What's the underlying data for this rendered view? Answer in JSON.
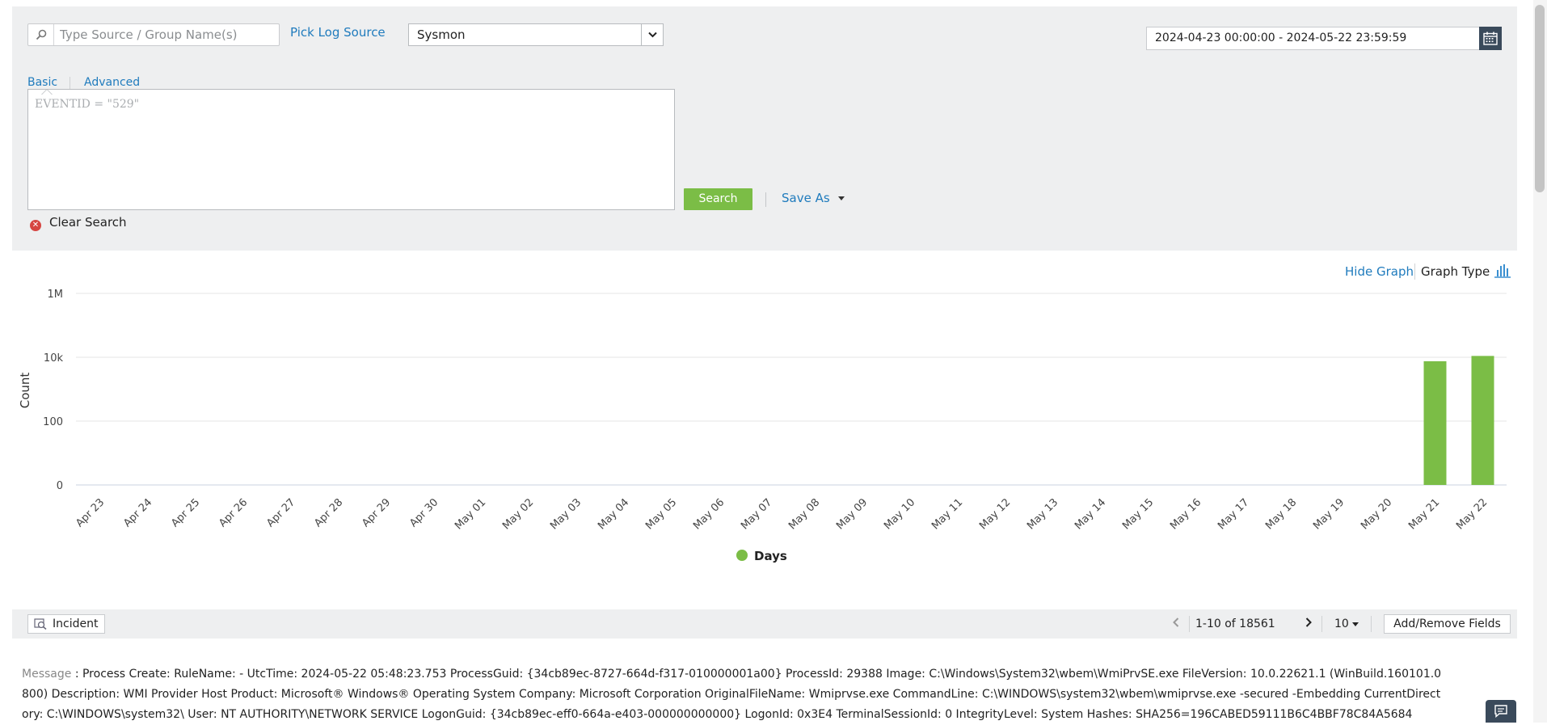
{
  "search": {
    "placeholder": "Type Source / Group Name(s)",
    "pick_log_source": "Pick Log Source",
    "log_source_selected": "Sysmon"
  },
  "date_range": "2024-04-23 00:00:00 - 2024-05-22 23:59:59",
  "tabs": {
    "basic": "Basic",
    "advanced": "Advanced",
    "active": "Basic"
  },
  "query": {
    "placeholder": "EVENTID = \"529\""
  },
  "actions": {
    "search": "Search",
    "save_as": "Save As",
    "clear_search": "Clear Search"
  },
  "graph_controls": {
    "hide_graph": "Hide Graph",
    "graph_type": "Graph Type"
  },
  "chart_data": {
    "type": "bar",
    "ylabel": "Count",
    "xlabel": "",
    "y_scale": "log",
    "y_ticks": [
      "0",
      "100",
      "10k",
      "1M"
    ],
    "categories": [
      "Apr 23",
      "Apr 24",
      "Apr 25",
      "Apr 26",
      "Apr 27",
      "Apr 28",
      "Apr 29",
      "Apr 30",
      "May 01",
      "May 02",
      "May 03",
      "May 04",
      "May 05",
      "May 06",
      "May 07",
      "May 08",
      "May 09",
      "May 10",
      "May 11",
      "May 12",
      "May 13",
      "May 14",
      "May 15",
      "May 16",
      "May 17",
      "May 18",
      "May 19",
      "May 20",
      "May 21",
      "May 22"
    ],
    "series": [
      {
        "name": "Days",
        "color": "#7bbd46",
        "values": [
          0,
          0,
          0,
          0,
          0,
          0,
          0,
          0,
          0,
          0,
          0,
          0,
          0,
          0,
          0,
          0,
          0,
          0,
          0,
          0,
          0,
          0,
          0,
          0,
          0,
          0,
          0,
          0,
          7500,
          11000
        ]
      }
    ],
    "legend_position": "bottom-center",
    "grid": true
  },
  "results_toolbar": {
    "incident": "Incident",
    "pager": "1-10 of 18561",
    "per_page": "10",
    "add_remove_fields": "Add/Remove Fields"
  },
  "result": {
    "label": "Message",
    "text": ": Process Create: RuleName: - UtcTime: 2024-05-22 05:48:23.753 ProcessGuid: {34cb89ec-8727-664d-f317-010000001a00} ProcessId: 29388 Image: C:\\Windows\\System32\\wbem\\WmiPrvSE.exe FileVersion: 10.0.22621.1 (WinBuild.160101.0800) Description: WMI Provider Host Product: Microsoft® Windows® Operating System Company: Microsoft Corporation OriginalFileName: Wmiprvse.exe CommandLine: C:\\WINDOWS\\system32\\wbem\\wmiprvse.exe -secured -Embedding CurrentDirectory: C:\\WINDOWS\\system32\\ User: NT AUTHORITY\\NETWORK SERVICE LogonGuid: {34cb89ec-eff0-664a-e403-000000000000} LogonId: 0x3E4 TerminalSessionId: 0 IntegrityLevel: System Hashes: SHA256=196CABED59111B6C4BBF78C84A5684"
  }
}
